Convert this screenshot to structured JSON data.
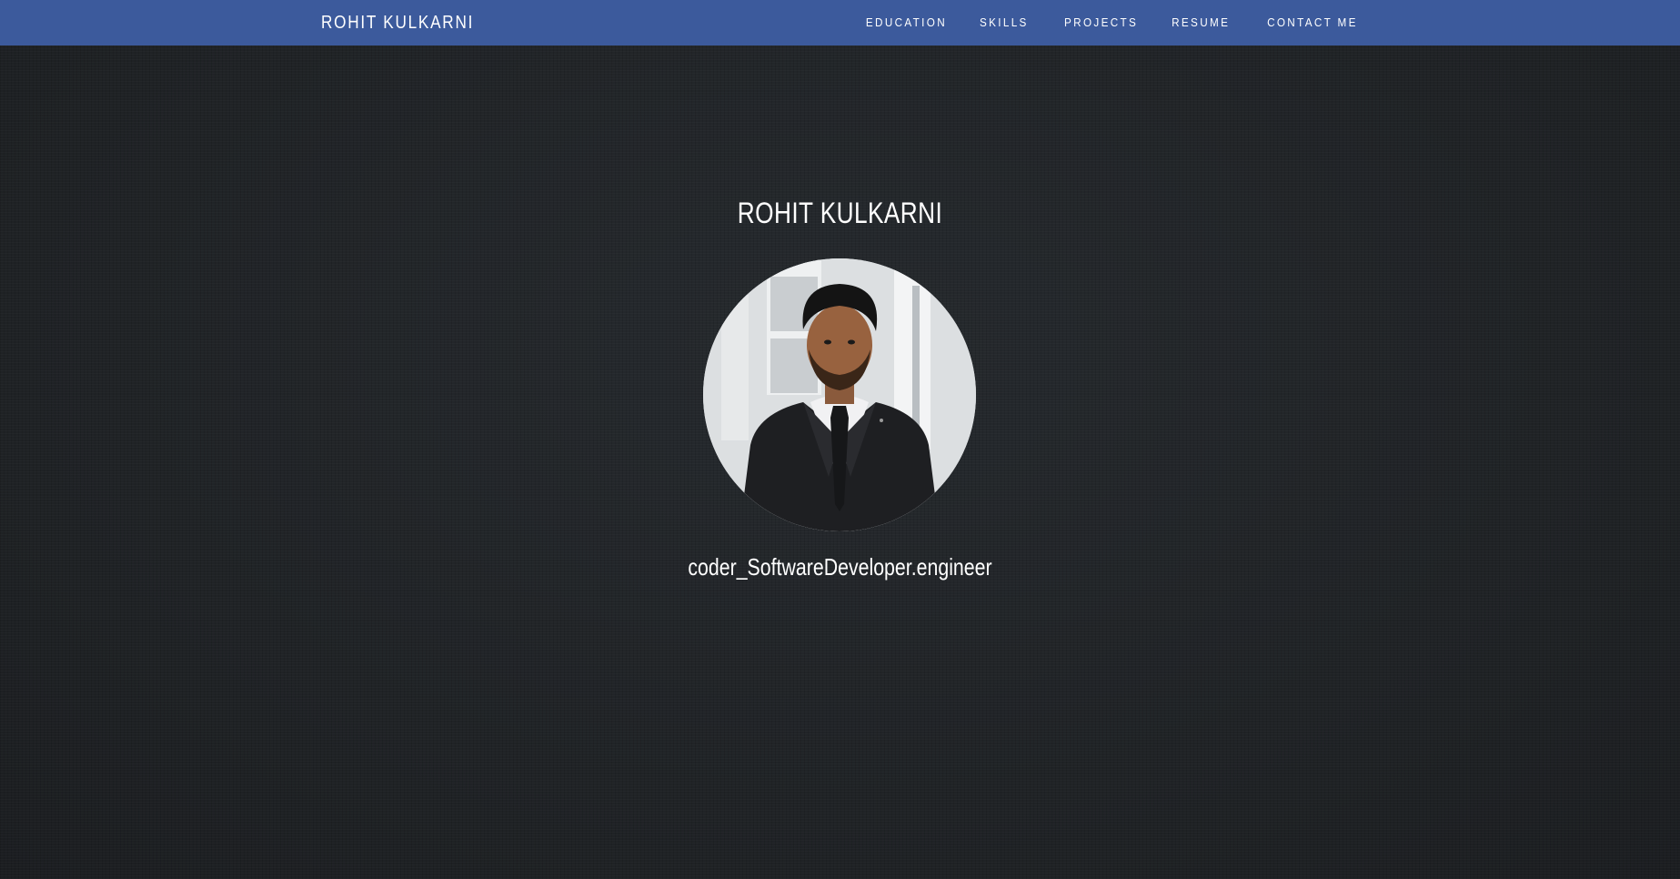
{
  "colors": {
    "navbar_bg": "#3c5a9c",
    "page_bg": "#202326",
    "text": "#ffffff"
  },
  "navbar": {
    "brand": "ROHIT KULKARNI",
    "links": [
      {
        "label": "EDUCATION"
      },
      {
        "label": "SKILLS"
      },
      {
        "label": "PROJECTS"
      },
      {
        "label": "RESUME"
      },
      {
        "label": "CONTACT ME"
      }
    ]
  },
  "hero": {
    "name": "ROHIT KULKARNI",
    "tagline": "coder_SoftwareDeveloper.engineer",
    "avatar_icon": "profile-photo"
  }
}
